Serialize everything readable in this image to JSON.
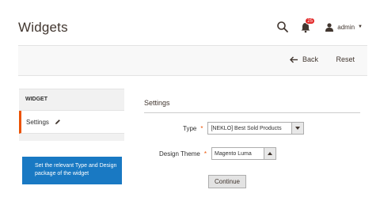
{
  "header": {
    "title": "Widgets",
    "notification_count": "25",
    "user_name": "admin"
  },
  "action_bar": {
    "back_label": "Back",
    "reset_label": "Reset"
  },
  "sidebar": {
    "title": "WIDGET",
    "items": [
      {
        "label": "Settings"
      }
    ],
    "hint": "Set the relevant Type and Design package of the widget"
  },
  "settings": {
    "title": "Settings",
    "fields": {
      "type": {
        "label": "Type",
        "value": "[NEKLO] Best Sold Products"
      },
      "design_theme": {
        "label": "Design Theme",
        "value": "Magento Luma"
      }
    },
    "continue_label": "Continue"
  },
  "colors": {
    "accent": "#eb5202",
    "hint_bg": "#1979c3",
    "badge": "#e22626"
  }
}
